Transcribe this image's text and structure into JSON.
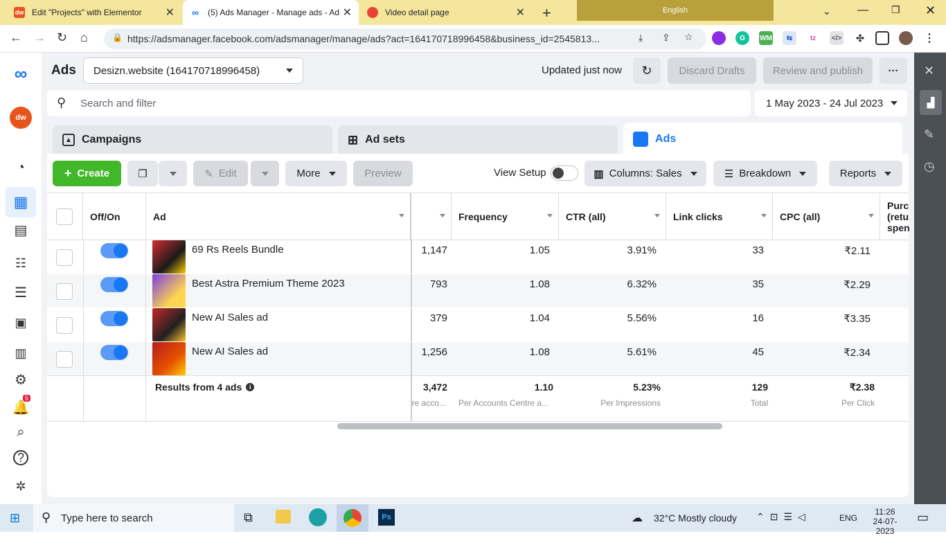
{
  "browser": {
    "tabs": [
      {
        "title": "Edit \"Projects\" with Elementor",
        "icon": "dw-icon",
        "active": false
      },
      {
        "title": "(5) Ads Manager - Manage ads - Ad",
        "icon": "meta-icon",
        "active": true
      },
      {
        "title": "Video detail page",
        "icon": "chrome-icon",
        "active": false
      }
    ],
    "language": "English",
    "url": "https://adsmanager.facebook.com/adsmanager/manage/ads?act=164170718996458&business_id=2545813..."
  },
  "header": {
    "ads_label": "Ads",
    "account": "Desizn.website (164170718996458)",
    "updated": "Updated just now",
    "discard": "Discard Drafts",
    "review": "Review and publish",
    "search_placeholder": "Search and filter",
    "date_range": "1 May 2023 - 24 Jul 2023"
  },
  "tabs": {
    "campaigns": "Campaigns",
    "adsets": "Ad sets",
    "ads": "Ads"
  },
  "toolbar": {
    "create": "Create",
    "edit": "Edit",
    "more": "More",
    "preview": "Preview",
    "view_setup": "View Setup",
    "columns": "Columns: Sales",
    "breakdown": "Breakdown",
    "reports": "Reports"
  },
  "table": {
    "headers": {
      "offon": "Off/On",
      "ad": "Ad",
      "frequency": "Frequency",
      "ctr": "CTR (all)",
      "link_clicks": "Link clicks",
      "cpc": "CPC (all)",
      "purchase": "Purc (retu spen"
    },
    "rows": [
      {
        "name": "69 Rs Reels Bundle",
        "reach": "1,147",
        "frequency": "1.05",
        "ctr": "3.91%",
        "link_clicks": "33",
        "cpc": "₹2.11",
        "on": true
      },
      {
        "name": "Best Astra Premium Theme 2023",
        "reach": "793",
        "frequency": "1.08",
        "ctr": "6.32%",
        "link_clicks": "35",
        "cpc": "₹2.29",
        "on": true
      },
      {
        "name": "New AI Sales ad",
        "reach": "379",
        "frequency": "1.04",
        "ctr": "5.56%",
        "link_clicks": "16",
        "cpc": "₹3.35",
        "on": true
      },
      {
        "name": "New AI Sales ad",
        "reach": "1,256",
        "frequency": "1.08",
        "ctr": "5.61%",
        "link_clicks": "45",
        "cpc": "₹2.34",
        "on": true
      }
    ],
    "summary": {
      "label": "Results from 4 ads",
      "reach": "3,472",
      "reach_sub": "re acco...",
      "frequency": "1.10",
      "frequency_sub": "Per Accounts Centre a...",
      "ctr": "5.23%",
      "ctr_sub": "Per Impressions",
      "link_clicks": "129",
      "link_clicks_sub": "Total",
      "cpc": "₹2.38",
      "cpc_sub": "Per Click"
    }
  },
  "left_rail": {
    "notification_count": "5"
  },
  "taskbar": {
    "search_placeholder": "Type here to search",
    "weather": "32°C  Mostly cloudy",
    "lang": "ENG",
    "time": "11:26",
    "date": "24-07-2023"
  }
}
